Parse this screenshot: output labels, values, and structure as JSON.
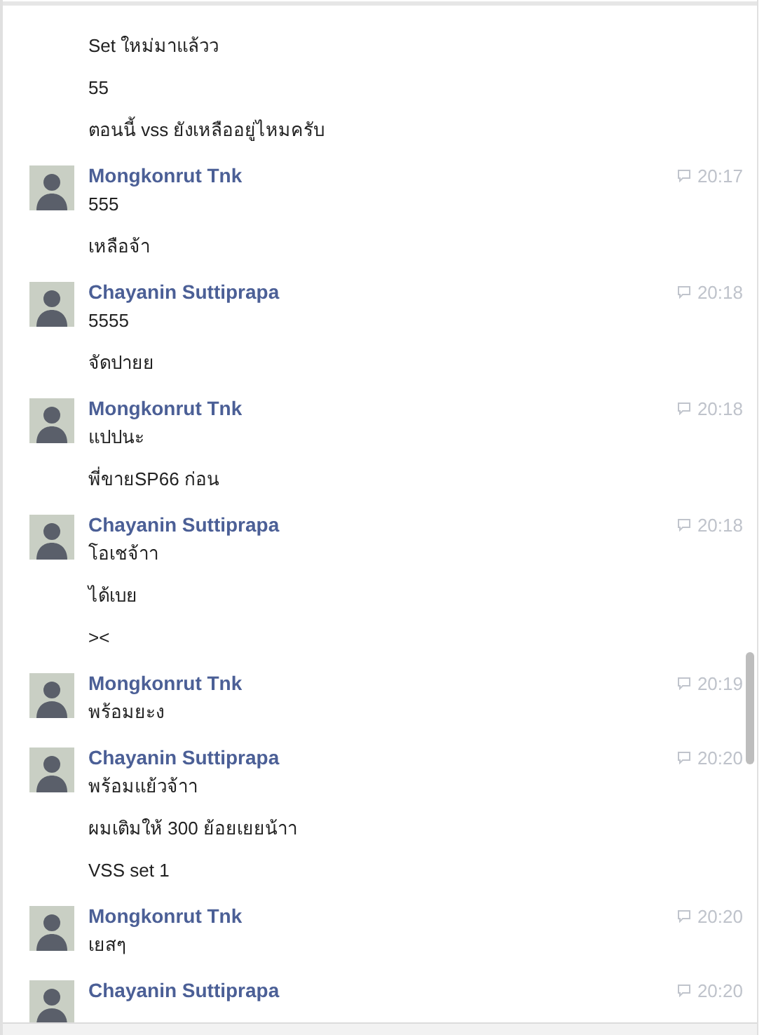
{
  "messages": [
    {
      "lines": [
        "Set ใหม่มาแล้วว",
        "55",
        "ตอนนี้ vss ยังเหลืออยู่ไหมครับ"
      ]
    },
    {
      "sender": "Mongkonrut Tnk",
      "time": "20:17",
      "lines": [
        "555",
        "เหลือจ้า"
      ]
    },
    {
      "sender": "Chayanin Suttiprapa",
      "time": "20:18",
      "lines": [
        "5555",
        "จัดปายย"
      ]
    },
    {
      "sender": "Mongkonrut Tnk",
      "time": "20:18",
      "lines": [
        "แปปนะ",
        "พี่ขายSP66 ก่อน"
      ]
    },
    {
      "sender": "Chayanin Suttiprapa",
      "time": "20:18",
      "lines": [
        "โอเชจ้าา",
        "ได้เบย",
        "><"
      ]
    },
    {
      "sender": "Mongkonrut Tnk",
      "time": "20:19",
      "lines": [
        "พร้อมยะง"
      ]
    },
    {
      "sender": "Chayanin Suttiprapa",
      "time": "20:20",
      "lines": [
        "พร้อมแย้วจ้าา",
        "ผมเติมให้ 300 ย้อยเยยน้าา",
        "VSS set 1"
      ]
    },
    {
      "sender": "Mongkonrut Tnk",
      "time": "20:20",
      "lines": [
        "เยสๆ"
      ]
    },
    {
      "sender": "Chayanin Suttiprapa",
      "time": "20:20"
    }
  ]
}
